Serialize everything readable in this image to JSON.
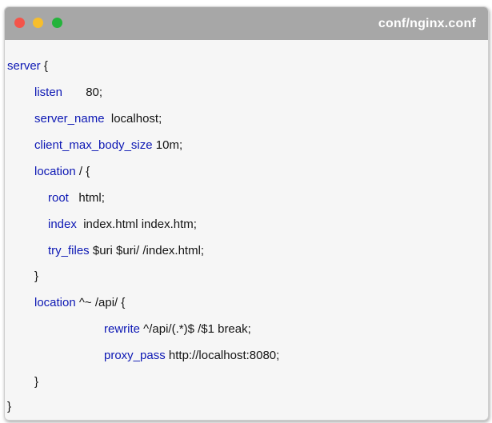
{
  "window": {
    "title": "conf/nginx.conf"
  },
  "lines": [
    {
      "kw": "server",
      "rest": " {"
    },
    {
      "kw": "listen",
      "rest": "       80;"
    },
    {
      "kw": "server_name",
      "rest": "  localhost;"
    },
    {
      "kw": "client_max_body_size",
      "rest": " 10m;"
    },
    {
      "kw": "location",
      "rest": " / {"
    },
    {
      "kw": "root",
      "rest": "   html;"
    },
    {
      "kw": "index",
      "rest": "  index.html index.htm;"
    },
    {
      "kw": "try_files",
      "rest": " $uri $uri/ /index.html;"
    },
    {
      "kw": "",
      "rest": "}"
    },
    {
      "kw": "location",
      "rest": " ^~ /api/ {"
    },
    {
      "kw": "rewrite",
      "rest": " ^/api/(.*)$ /$1 break;"
    },
    {
      "kw": "proxy_pass",
      "rest": " http://localhost:8080;"
    },
    {
      "kw": "",
      "rest": "}"
    },
    {
      "kw": "",
      "rest": "}"
    }
  ],
  "colors": {
    "keyword": "#0d18b4",
    "titlebar": "#a7a7a7",
    "close": "#f4544a",
    "minimize": "#f7be2c",
    "maximize": "#24b33b"
  }
}
